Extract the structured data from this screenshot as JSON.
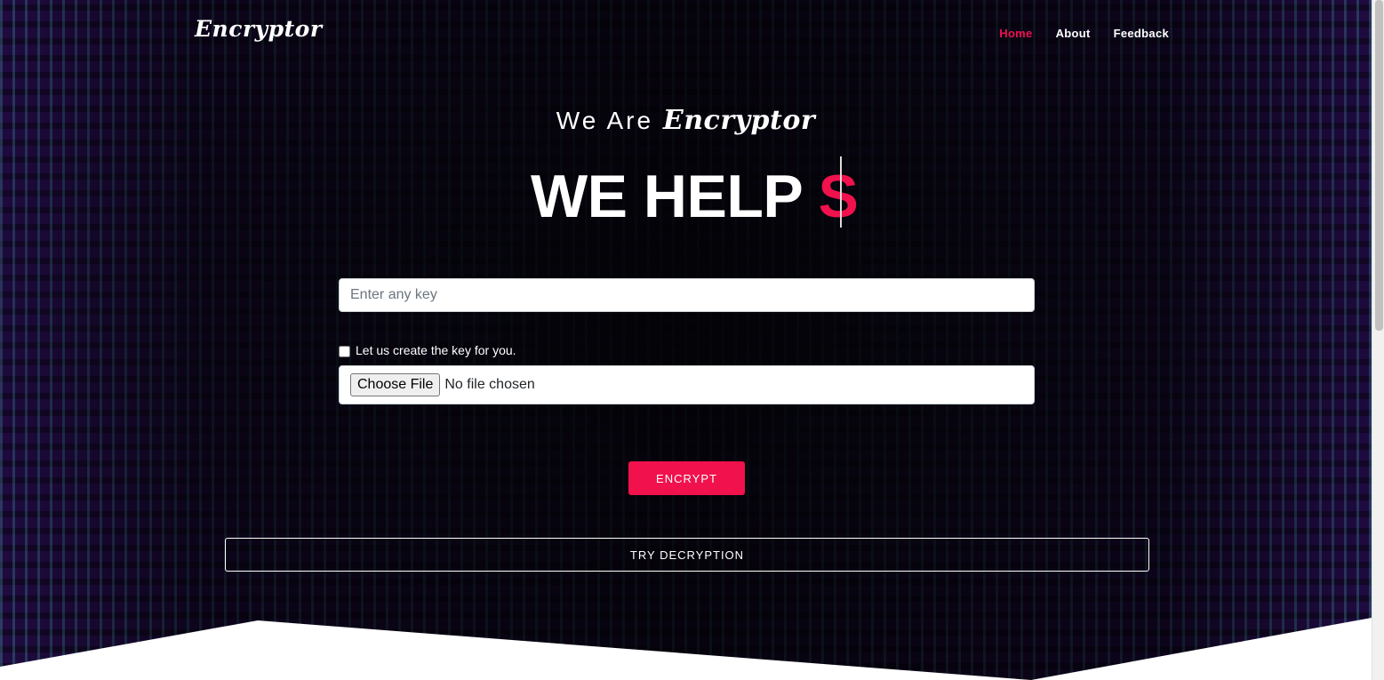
{
  "brand": "Encryptor",
  "nav": {
    "home": "Home",
    "about": "About",
    "feedback": "Feedback",
    "active": "home",
    "active_color": "#f0114d"
  },
  "hero": {
    "subtitle_prefix": "We Are",
    "subtitle_brand": "Encryptor",
    "headline": "WE HELP ",
    "headline_typed": "S"
  },
  "form": {
    "key_placeholder": "Enter any key",
    "key_value": "",
    "auto_key_label": "Let us create the key for you.",
    "auto_key_checked": false,
    "file_button": "Choose File",
    "file_status": "No file chosen",
    "encrypt_label": "ENCRYPT",
    "decrypt_label": "TRY DECRYPTION"
  },
  "colors": {
    "accent": "#f0114d",
    "matrix_glyph": "#5de0c8",
    "background": "#120828"
  }
}
